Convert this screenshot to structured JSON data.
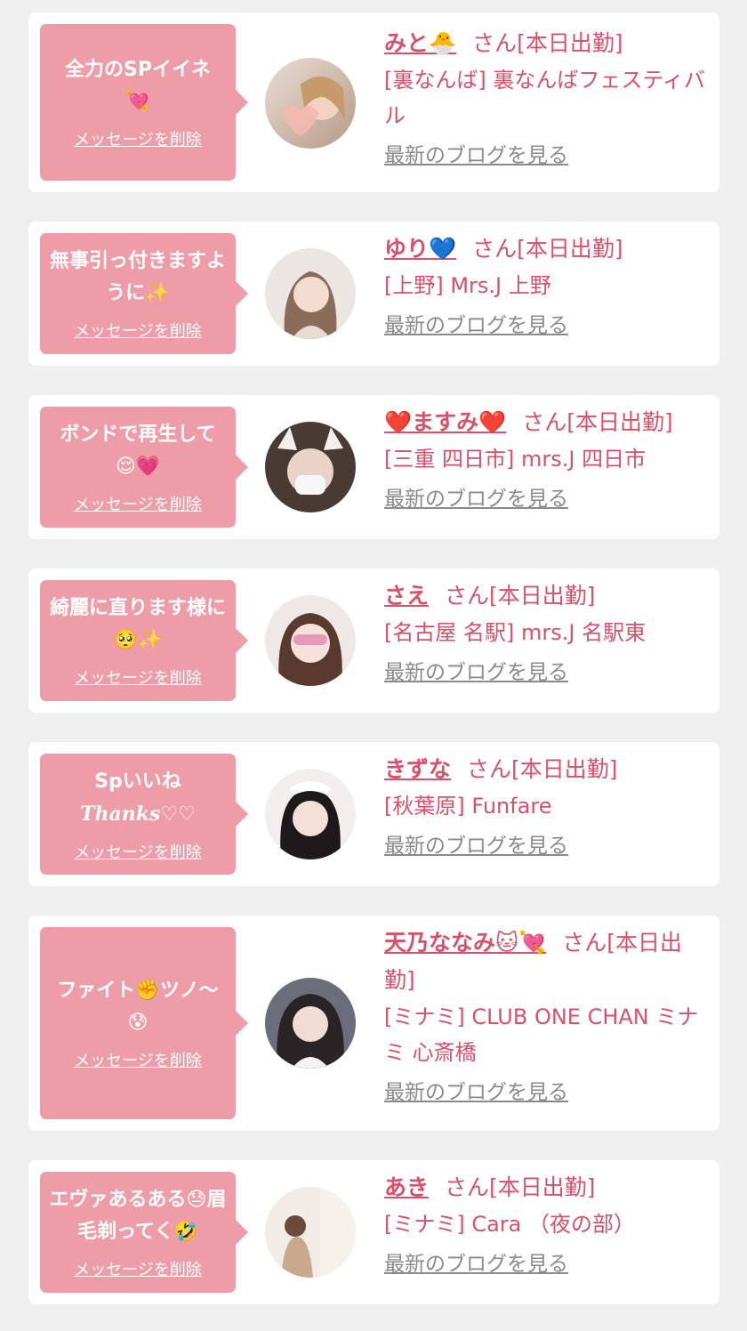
{
  "colors": {
    "accent": "#d9506a",
    "bubble": "#ee9ca7",
    "page_bg": "#efefef",
    "card_bg": "#ffffff",
    "link_gray": "#8a8a8a"
  },
  "cards": [
    {
      "message": "全力のSPイイネ",
      "message_emoji": "💘",
      "delete_label": "メッセージを削除",
      "name": "みと",
      "name_emoji": "🐣",
      "san": "さん[本日出勤]",
      "shop": "[裏なんば] 裏なんばフェスティバル",
      "blog_label": "最新のブログを見る",
      "avatar_icon": "avatar-photo"
    },
    {
      "message": "無事引っ付きますように",
      "message_emoji": "✨",
      "delete_label": "メッセージを削除",
      "name": "ゆり",
      "name_emoji": "💙",
      "san": "さん[本日出勤]",
      "shop": "[上野] Mrs.J 上野",
      "blog_label": "最新のブログを見る",
      "avatar_icon": "avatar-photo"
    },
    {
      "message": "ボンドで再生して",
      "message_emoji": "😌💗",
      "delete_label": "メッセージを削除",
      "name": "❤️ますみ❤️",
      "name_emoji": "",
      "san": "さん[本日出勤]",
      "shop": "[三重 四日市] mrs.J 四日市",
      "blog_label": "最新のブログを見る",
      "avatar_icon": "avatar-photo"
    },
    {
      "message": "綺麗に直ります様に",
      "message_emoji": "🥺✨",
      "delete_label": "メッセージを削除",
      "name": "さえ",
      "name_emoji": "",
      "san": "さん[本日出勤]",
      "shop": "[名古屋 名駅] mrs.J 名駅東",
      "blog_label": "最新のブログを見る",
      "avatar_icon": "avatar-photo"
    },
    {
      "message": "Spいいね",
      "message_emoji": "Thanks♡♡",
      "delete_label": "メッセージを削除",
      "name": "きずな",
      "name_emoji": "",
      "san": "さん[本日出勤]",
      "shop": "[秋葉原] Funfare",
      "blog_label": "最新のブログを見る",
      "avatar_icon": "avatar-photo"
    },
    {
      "message": "ファイト✊ツノ〜",
      "message_emoji": "😰",
      "delete_label": "メッセージを削除",
      "name": "天乃ななみ",
      "name_emoji": "🐱💘",
      "san": "さん[本日出勤]",
      "shop": "[ミナミ] CLUB ONE CHAN ミナミ 心斎橋",
      "blog_label": "最新のブログを見る",
      "avatar_icon": "avatar-photo"
    },
    {
      "message": "エヴァあるある😓眉毛剃ってく",
      "message_emoji": "🤣",
      "delete_label": "メッセージを削除",
      "name": "あき",
      "name_emoji": "",
      "san": "さん[本日出勤]",
      "shop": "[ミナミ] Cara （夜の部）",
      "blog_label": "最新のブログを見る",
      "avatar_icon": "avatar-photo"
    }
  ]
}
